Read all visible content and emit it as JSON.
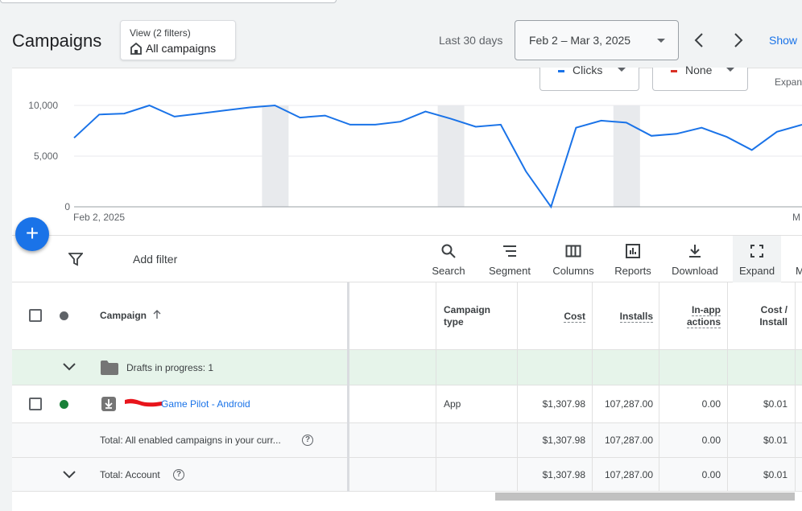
{
  "header": {
    "title": "Campaigns",
    "view": {
      "label": "View (2 filters)",
      "value": "All campaigns"
    },
    "date_range_label": "Last 30 days",
    "date_range_value": "Feb 2 – Mar 3, 2025",
    "show_link": "Show"
  },
  "chart_controls": {
    "metric1": {
      "label": "Clicks",
      "color": "#1a73e8"
    },
    "metric2": {
      "label": "None",
      "color": "#d93025"
    },
    "expand_label": "Expan"
  },
  "chart_data": {
    "type": "line",
    "x_start_label": "Feb 2, 2025",
    "x_end_label": "M",
    "y_ticks": [
      "10,000",
      "5,000",
      "0"
    ],
    "ylim": [
      0,
      10000
    ],
    "series": [
      {
        "color": "#1a73e8",
        "values": [
          6800,
          9100,
          9200,
          10000,
          8900,
          9200,
          9500,
          9800,
          10000,
          8800,
          9000,
          8100,
          8100,
          8400,
          9400,
          8700,
          7900,
          8100,
          3500,
          0,
          7800,
          8500,
          8300,
          7000,
          7200,
          7800,
          6900,
          5600,
          7400,
          8100
        ]
      }
    ]
  },
  "toolbar": {
    "add_filter": "Add filter",
    "tools": [
      "Search",
      "Segment",
      "Columns",
      "Reports",
      "Download",
      "Expand",
      "M"
    ]
  },
  "table": {
    "headers": {
      "campaign": "Campaign",
      "campaign_type": [
        "Campaign",
        "type"
      ],
      "cost": "Cost",
      "installs": "Installs",
      "inapp": [
        "In-app",
        "actions"
      ],
      "cpi": [
        "Cost /",
        "Install"
      ]
    },
    "draft_row": {
      "label": "Drafts in progress: 1"
    },
    "rows": [
      {
        "name": "Game Pilot - Android",
        "type": "App",
        "cost": "$1,307.98",
        "installs": "107,287.00",
        "inapp": "0.00",
        "cpi": "$0.01",
        "status_color": "#188038"
      }
    ],
    "total_enabled": {
      "label": "Total: All enabled campaigns in your curr...",
      "cost": "$1,307.98",
      "installs": "107,287.00",
      "inapp": "0.00",
      "cpi": "$0.01"
    },
    "total_account": {
      "label": "Total: Account",
      "cost": "$1,307.98",
      "installs": "107,287.00",
      "inapp": "0.00",
      "cpi": "$0.01"
    }
  }
}
